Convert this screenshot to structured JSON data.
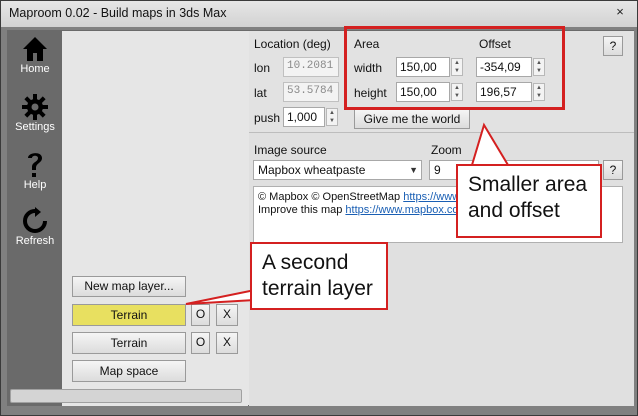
{
  "window": {
    "title": "Maproom 0.02 - Build maps in 3ds Max",
    "close_glyph": "×"
  },
  "sidebar": {
    "items": [
      {
        "label": "Home",
        "icon": "home-icon"
      },
      {
        "label": "Settings",
        "icon": "gear-icon"
      },
      {
        "label": "Help",
        "icon": "help-icon"
      },
      {
        "label": "Refresh",
        "icon": "refresh-icon"
      }
    ]
  },
  "location": {
    "heading": "Location (deg)",
    "lon_label": "lon",
    "lon_value": "10.2081",
    "lat_label": "lat",
    "lat_value": "53.5784",
    "push_label": "push",
    "push_value": "1,000"
  },
  "area": {
    "heading": "Area",
    "width_label": "width",
    "width_value": "150,00",
    "height_label": "height",
    "height_value": "150,00"
  },
  "offset": {
    "heading": "Offset",
    "x_value": "-354,09",
    "y_value": "196,57"
  },
  "help_button": "?",
  "give_world_button": "Give me the world",
  "image_source": {
    "heading": "Image source",
    "selected": "Mapbox wheatpaste"
  },
  "zoom": {
    "heading": "Zoom",
    "value": "9",
    "help": "?"
  },
  "attribution": {
    "line1_prefix": "© Mapbox © OpenStreetMap ",
    "line1_link": "https://www",
    "line2_prefix": "Improve this map ",
    "line2_link": "https://www.mapbox.com"
  },
  "layers": {
    "new_button": "New map layer...",
    "rows": [
      {
        "label": "Terrain",
        "o": "O",
        "x": "X"
      },
      {
        "label": "Terrain",
        "o": "O",
        "x": "X"
      }
    ],
    "map_space_button": "Map space"
  },
  "annotations": {
    "callout_area": "Smaller area and offset",
    "callout_terrain": "A second terrain layer",
    "accent_color": "#d42020",
    "selected_layer_color": "#e8e060"
  }
}
